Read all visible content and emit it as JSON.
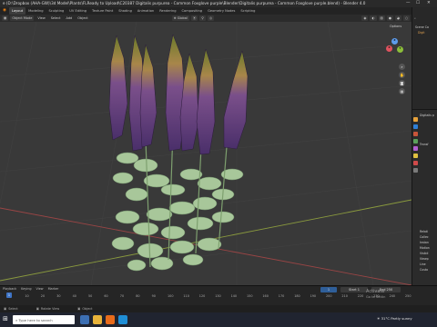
{
  "window": {
    "title": "e (D:\\Dropbox (AHA-GW)\\3d Model\\Plants\\FLReady to Upload\\C20387 Digitalis purpurea - Common Foxglove purple\\Blender\\Digitalis purpurea - Common Foxglove purple.blend) - Blender 4.0"
  },
  "workspaces": [
    "Layout",
    "Modeling",
    "Sculpting",
    "UV Editing",
    "Texture Paint",
    "Shading",
    "Animation",
    "Rendering",
    "Compositing",
    "Geometry Nodes",
    "Scripting"
  ],
  "scene_label": "Scene",
  "viewport_header": {
    "mode": "Object Mode",
    "menus": [
      "View",
      "Select",
      "Add",
      "Object"
    ],
    "transform": "Global",
    "options_label": "Options"
  },
  "outliner": {
    "items": [
      "Scene Co",
      "Digit"
    ]
  },
  "properties": {
    "object_name": "Digitalis p",
    "sections": [
      "Transf",
      "Relati",
      "Collec",
      "Instan",
      "Motion",
      "Visibil",
      "Viewp",
      "Line",
      "Custo"
    ],
    "colors": [
      "#e8a23a",
      "#2f7fd6",
      "#c8553a",
      "#5aa05a",
      "#b35fd0",
      "#d04a4a",
      "#e0c040",
      "#7a7a7a"
    ]
  },
  "timeline": {
    "playback_label": "Playback",
    "keying_label": "Keying",
    "view_label": "View",
    "marker_label": "Marker",
    "ticks": [
      "0",
      "10",
      "20",
      "30",
      "40",
      "50",
      "60",
      "70",
      "80",
      "90",
      "100",
      "110",
      "120",
      "130",
      "140",
      "150",
      "160",
      "170",
      "180",
      "190",
      "200",
      "210",
      "220",
      "230",
      "240",
      "250"
    ],
    "current_frame": "1",
    "start_label": "Start",
    "start": "1",
    "end_label": "End",
    "end": "250"
  },
  "status": {
    "left": "Select",
    "mid": "Rotate View",
    "right": "Object"
  },
  "watermark": {
    "line1": "Activate",
    "line2": "Go to Settin"
  },
  "taskbar": {
    "search_text": "Type here to search",
    "weather": "31°C  Partly sunny"
  }
}
